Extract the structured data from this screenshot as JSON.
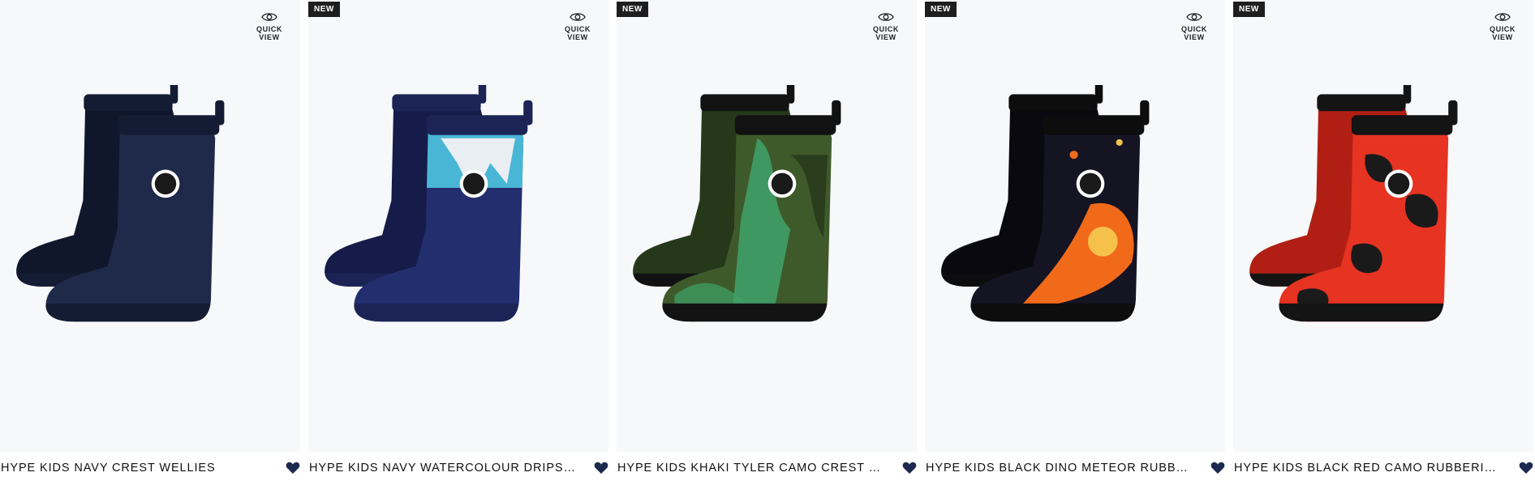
{
  "quick_view_label": "QUICK VIEW",
  "products": [
    {
      "name": "HYPE KIDS NAVY CREST WELLIES",
      "badge": "",
      "colors": {
        "main": "#1f2a4a",
        "shade": "#10172c",
        "sole": "#141c33",
        "pattern": "none"
      },
      "wishlist_icon": "heart-icon"
    },
    {
      "name": "HYPE KIDS NAVY WATERCOLOUR DRIPS CRES...",
      "badge": "NEW",
      "colors": {
        "main": "#232e6e",
        "shade": "#151c4a",
        "sole": "#1c2456",
        "pattern": "drips",
        "accent1": "#49b6d6",
        "accent2": "#e9eef2"
      },
      "wishlist_icon": "heart-icon"
    },
    {
      "name": "HYPE KIDS KHAKI TYLER CAMO CREST WELLI...",
      "badge": "NEW",
      "colors": {
        "main": "#3f5a2a",
        "shade": "#26381a",
        "sole": "#121212",
        "pattern": "camo-green",
        "accent1": "#3fa36b",
        "accent2": "#1c2a14"
      },
      "wishlist_icon": "heart-icon"
    },
    {
      "name": "HYPE KIDS BLACK DINO METEOR RUBBERISE...",
      "badge": "NEW",
      "colors": {
        "main": "#141422",
        "shade": "#09090f",
        "sole": "#0d0d0d",
        "pattern": "meteor",
        "accent1": "#f06a1a",
        "accent2": "#f6c14a"
      },
      "wishlist_icon": "heart-icon"
    },
    {
      "name": "HYPE KIDS BLACK RED CAMO RUBBERISED C...",
      "badge": "NEW",
      "colors": {
        "main": "#e63322",
        "shade": "#b11f14",
        "sole": "#141414",
        "pattern": "camo-red",
        "accent1": "#1a1a1a",
        "accent2": "#f04a34"
      },
      "wishlist_icon": "heart-icon"
    }
  ],
  "wishlist_color": "#1c2a4f"
}
